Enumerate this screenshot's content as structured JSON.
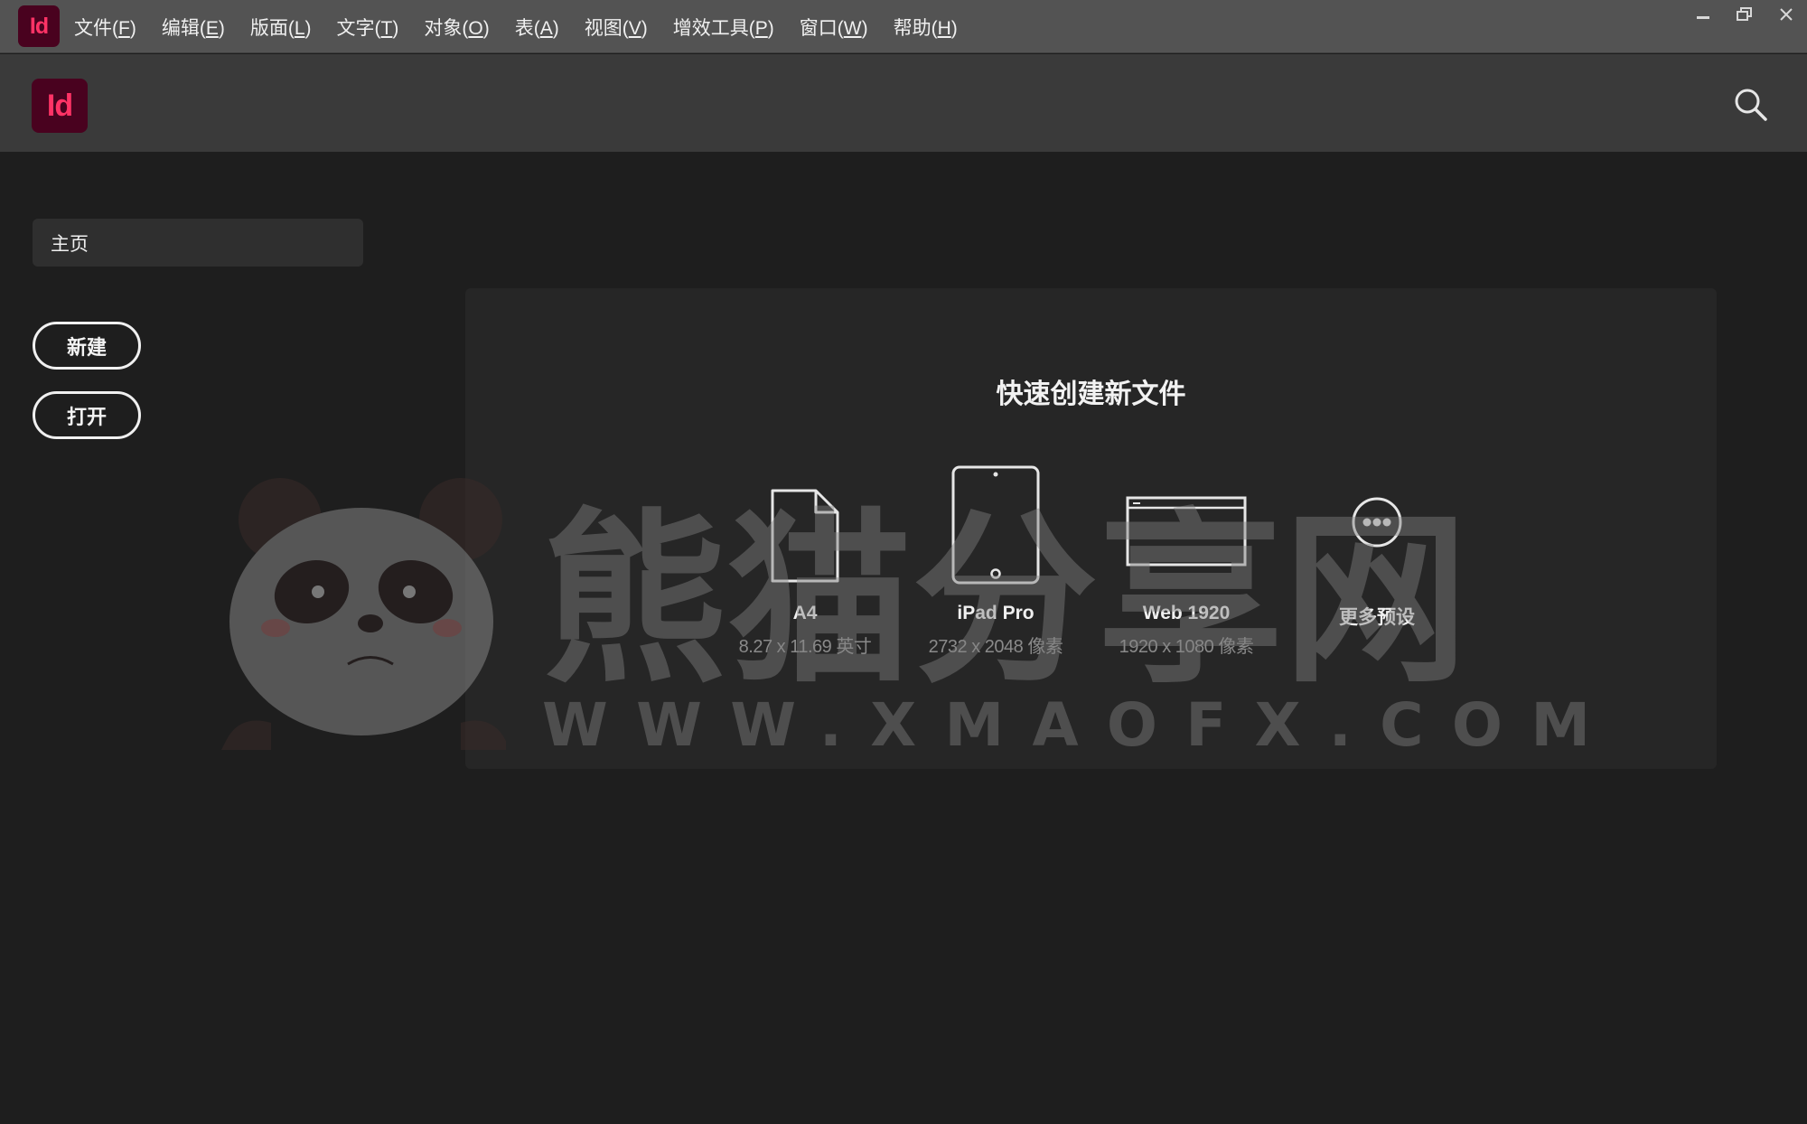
{
  "app": {
    "badge": "Id",
    "accent_color": "#ff3366",
    "badge_bg": "#49021f"
  },
  "menu": [
    {
      "label": "文件(",
      "key": "F",
      "tail": ")"
    },
    {
      "label": "编辑(",
      "key": "E",
      "tail": ")"
    },
    {
      "label": "版面(",
      "key": "L",
      "tail": ")"
    },
    {
      "label": "文字(",
      "key": "T",
      "tail": ")"
    },
    {
      "label": "对象(",
      "key": "O",
      "tail": ")"
    },
    {
      "label": "表(",
      "key": "A",
      "tail": ")"
    },
    {
      "label": "视图(",
      "key": "V",
      "tail": ")"
    },
    {
      "label": "增效工具(",
      "key": "P",
      "tail": ")"
    },
    {
      "label": "窗口(",
      "key": "W",
      "tail": ")"
    },
    {
      "label": "帮助(",
      "key": "H",
      "tail": ")"
    }
  ],
  "window_controls": [
    "minimize-icon",
    "restore-icon",
    "close-icon"
  ],
  "header": {
    "logo": "Id",
    "search_icon": "search-icon"
  },
  "sidebar": {
    "home": "主页",
    "new_button": "新建",
    "open_button": "打开"
  },
  "quick_create": {
    "title": "快速创建新文件",
    "presets": [
      {
        "name": "A4",
        "size": "8.27 x 11.69 英寸",
        "icon": "page-icon"
      },
      {
        "name": "iPad Pro",
        "size": "2732 x 2048 像素",
        "icon": "tablet-icon"
      },
      {
        "name": "Web 1920",
        "size": "1920 x 1080 像素",
        "icon": "browser-icon"
      },
      {
        "name": "更多预设",
        "size": "",
        "icon": "more-icon"
      }
    ]
  },
  "watermark": {
    "title": "熊猫分享网",
    "url": "WWW.XMAOFX.COM"
  }
}
